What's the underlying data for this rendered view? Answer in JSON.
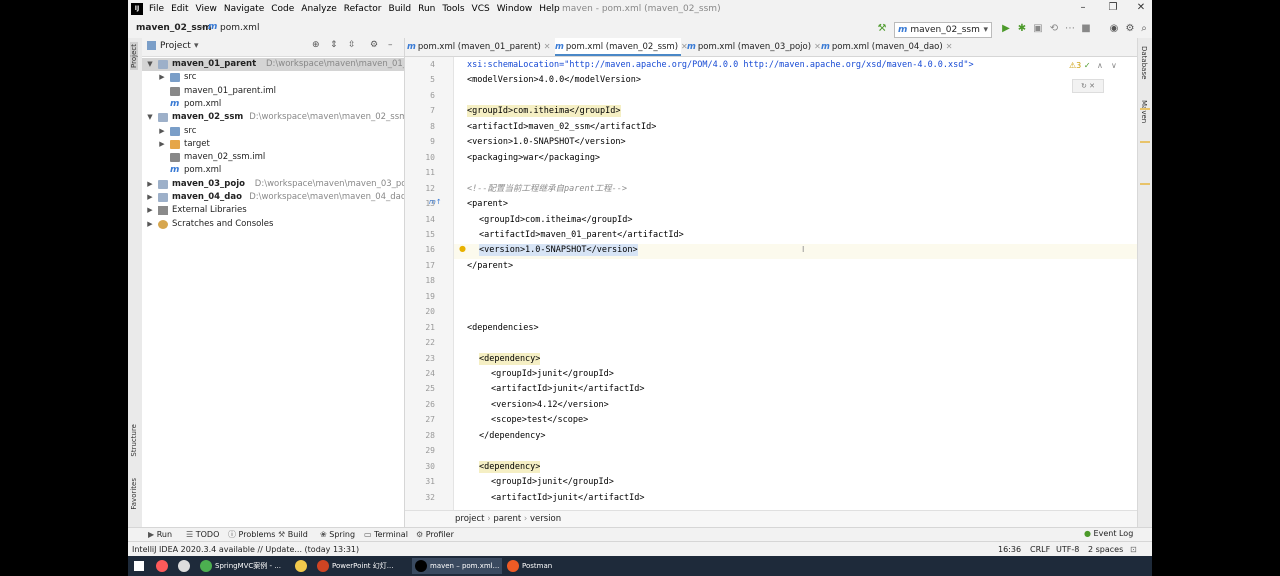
{
  "window": {
    "title": "maven - pom.xml (maven_02_ssm)",
    "menu": [
      "File",
      "Edit",
      "View",
      "Navigate",
      "Code",
      "Analyze",
      "Refactor",
      "Build",
      "Run",
      "Tools",
      "VCS",
      "Window",
      "Help"
    ]
  },
  "navbar": {
    "project": "maven_02_ssm",
    "file": "pom.xml",
    "run_config": "maven_02_ssm"
  },
  "left_stripe": {
    "project": "Project",
    "structure": "Structure",
    "favorites": "Favorites"
  },
  "right_stripe": {
    "database": "Database",
    "maven": "Maven"
  },
  "project_panel": {
    "title": "Project",
    "tree": [
      {
        "label": "maven_01_parent",
        "path": "D:\\workspace\\maven\\maven_01_parent",
        "icon": "module-folder-icon",
        "bold": true,
        "expanded": true,
        "indent": 0,
        "selected": true
      },
      {
        "label": "src",
        "path": "",
        "icon": "folder-icon",
        "indent": 1,
        "arrow": "collapsed"
      },
      {
        "label": "maven_01_parent.iml",
        "path": "",
        "icon": "iml-file-icon",
        "indent": 1
      },
      {
        "label": "pom.xml",
        "path": "",
        "icon": "maven-file-icon",
        "indent": 1
      },
      {
        "label": "maven_02_ssm",
        "path": "D:\\workspace\\maven\\maven_02_ssm",
        "icon": "module-folder-icon",
        "bold": true,
        "expanded": true,
        "indent": 0
      },
      {
        "label": "src",
        "path": "",
        "icon": "folder-icon",
        "indent": 1,
        "arrow": "collapsed"
      },
      {
        "label": "target",
        "path": "",
        "icon": "target-folder-icon",
        "indent": 1,
        "arrow": "collapsed"
      },
      {
        "label": "maven_02_ssm.iml",
        "path": "",
        "icon": "iml-file-icon",
        "indent": 1
      },
      {
        "label": "pom.xml",
        "path": "",
        "icon": "maven-file-icon",
        "indent": 1
      },
      {
        "label": "maven_03_pojo",
        "path": "D:\\workspace\\maven\\maven_03_pojo",
        "icon": "module-folder-icon",
        "bold": true,
        "indent": 0,
        "arrow": "collapsed"
      },
      {
        "label": "maven_04_dao",
        "path": "D:\\workspace\\maven\\maven_04_dao",
        "icon": "module-folder-icon",
        "bold": true,
        "indent": 0,
        "arrow": "collapsed"
      },
      {
        "label": "External Libraries",
        "path": "",
        "icon": "library-icon",
        "indent": 0,
        "arrow": "collapsed"
      },
      {
        "label": "Scratches and Consoles",
        "path": "",
        "icon": "scratches-icon",
        "indent": 0,
        "arrow": "collapsed"
      }
    ]
  },
  "editor": {
    "tabs": [
      {
        "label": "pom.xml (maven_01_parent)",
        "active": false
      },
      {
        "label": "pom.xml (maven_02_ssm)",
        "active": true
      },
      {
        "label": "pom.xml (maven_03_pojo)",
        "active": false
      },
      {
        "label": "pom.xml (maven_04_dao)",
        "active": false
      }
    ],
    "inspection": "3",
    "lines": [
      {
        "n": "4",
        "indent": 1,
        "text": "xsi:schemaLocation=\"http://maven.apache.org/POM/4.0.0 http://maven.apache.org/xsd/maven-4.0.0.xsd\">",
        "kind": "attr"
      },
      {
        "n": "5",
        "indent": 1,
        "text": "<modelVersion>4.0.0</modelVersion>",
        "kind": "tag"
      },
      {
        "n": "6",
        "indent": 0,
        "text": "",
        "kind": "tag"
      },
      {
        "n": "7",
        "indent": 1,
        "text": "<groupId>com.itheima</groupId>",
        "kind": "highlight"
      },
      {
        "n": "8",
        "indent": 1,
        "text": "<artifactId>maven_02_ssm</artifactId>",
        "kind": "tag"
      },
      {
        "n": "9",
        "indent": 1,
        "text": "<version>1.0-SNAPSHOT</version>",
        "kind": "tag"
      },
      {
        "n": "10",
        "indent": 1,
        "text": "<packaging>war</packaging>",
        "kind": "tag"
      },
      {
        "n": "11",
        "indent": 0,
        "text": "",
        "kind": "tag"
      },
      {
        "n": "12",
        "indent": 1,
        "text": "<!--配置当前工程继承自parent工程-->",
        "kind": "comment"
      },
      {
        "n": "13",
        "indent": 1,
        "text": "<parent>",
        "kind": "tag"
      },
      {
        "n": "14",
        "indent": 2,
        "text": "<groupId>com.itheima</groupId>",
        "kind": "tag"
      },
      {
        "n": "15",
        "indent": 2,
        "text": "<artifactId>maven_01_parent</artifactId>",
        "kind": "tag"
      },
      {
        "n": "16",
        "indent": 2,
        "text": "<version>1.0-SNAPSHOT</version>",
        "kind": "current"
      },
      {
        "n": "17",
        "indent": 1,
        "text": "</parent>",
        "kind": "tag"
      },
      {
        "n": "18",
        "indent": 0,
        "text": "",
        "kind": "tag"
      },
      {
        "n": "19",
        "indent": 0,
        "text": "",
        "kind": "tag"
      },
      {
        "n": "20",
        "indent": 0,
        "text": "",
        "kind": "tag"
      },
      {
        "n": "21",
        "indent": 1,
        "text": "<dependencies>",
        "kind": "tag"
      },
      {
        "n": "22",
        "indent": 0,
        "text": "",
        "kind": "tag"
      },
      {
        "n": "23",
        "indent": 2,
        "text": "<dependency>",
        "kind": "highlight"
      },
      {
        "n": "24",
        "indent": 3,
        "text": "<groupId>junit</groupId>",
        "kind": "tag"
      },
      {
        "n": "25",
        "indent": 3,
        "text": "<artifactId>junit</artifactId>",
        "kind": "tag"
      },
      {
        "n": "26",
        "indent": 3,
        "text": "<version>4.12</version>",
        "kind": "tag"
      },
      {
        "n": "27",
        "indent": 3,
        "text": "<scope>test</scope>",
        "kind": "tag"
      },
      {
        "n": "28",
        "indent": 2,
        "text": "</dependency>",
        "kind": "tag"
      },
      {
        "n": "29",
        "indent": 0,
        "text": "",
        "kind": "tag"
      },
      {
        "n": "30",
        "indent": 2,
        "text": "<dependency>",
        "kind": "highlight"
      },
      {
        "n": "31",
        "indent": 3,
        "text": "<groupId>junit</groupId>",
        "kind": "tag"
      },
      {
        "n": "32",
        "indent": 3,
        "text": "<artifactId>junit</artifactId>",
        "kind": "tag"
      }
    ]
  },
  "breadcrumb": [
    "project",
    "parent",
    "version"
  ],
  "bottom_tools": [
    "Run",
    "TODO",
    "Problems",
    "Build",
    "Spring",
    "Terminal",
    "Profiler"
  ],
  "bottom_tools_right": "Event Log",
  "status": {
    "message": "IntelliJ IDEA 2020.3.4 available // Update... (today 13:31)",
    "position": "16:36",
    "line_sep": "CRLF",
    "encoding": "UTF-8",
    "indent": "2 spaces"
  },
  "taskbar": [
    {
      "label": "",
      "icon": "start-icon",
      "color": "#ffffff"
    },
    {
      "label": "",
      "icon": "search-icon",
      "color": "#ff5a5a"
    },
    {
      "label": "",
      "icon": "taskview-icon",
      "color": "#dddddd"
    },
    {
      "label": "SpringMVC案例 - ...",
      "icon": "chrome-icon",
      "color": "#4caf50"
    },
    {
      "label": "",
      "icon": "explorer-icon",
      "color": "#f2c94c"
    },
    {
      "label": "PowerPoint 幻灯...",
      "icon": "powerpoint-icon",
      "color": "#d04423"
    },
    {
      "label": "maven – pom.xml...",
      "icon": "intellij-icon",
      "color": "#000000"
    },
    {
      "label": "Postman",
      "icon": "postman-icon",
      "color": "#ef5b25"
    }
  ]
}
